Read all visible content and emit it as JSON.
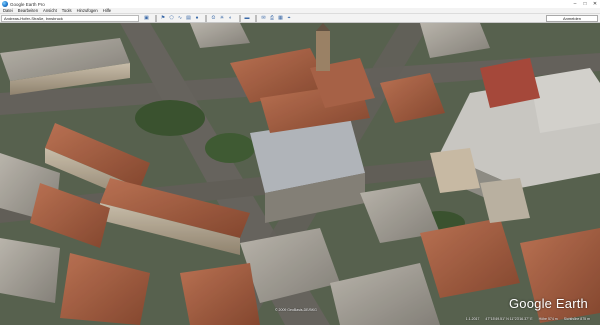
{
  "window": {
    "title": "Google Earth Pro"
  },
  "menu": {
    "items": [
      "Datei",
      "Bearbeiten",
      "Ansicht",
      "Tools",
      "Hinzufügen",
      "Hilfe"
    ]
  },
  "toolbar": {
    "search_value": "Andreas-Hofer-Straße, Innsbruck",
    "signin_label": "Anmelden"
  },
  "map": {
    "watermark": "Google Earth",
    "copyright": "© 2009 GeoBasis-DE/BKG",
    "status": {
      "date": "1.1.2017",
      "coords": "47°15'49.51\" N  11°23'16.37\" E",
      "elevation": "Höhe 574 m",
      "eye_alt": "Sichthöhe 875 m"
    }
  },
  "colors": {
    "accent": "#3b6aa8"
  }
}
